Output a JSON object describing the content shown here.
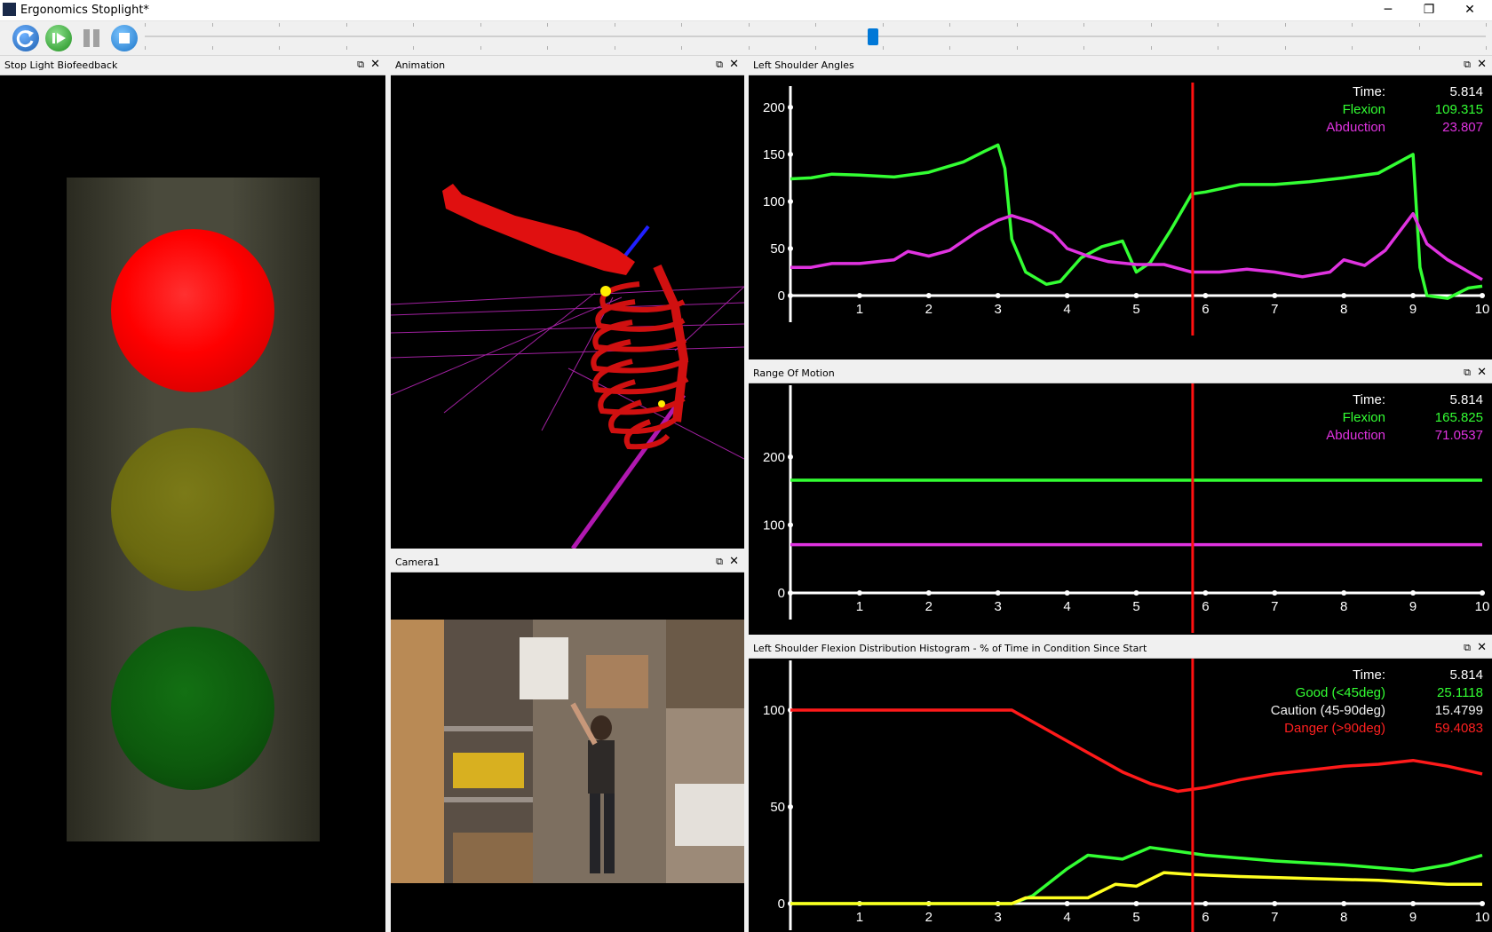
{
  "window": {
    "title": "Ergonomics Stoplight*",
    "minimize": "─",
    "maximize": "❐",
    "close": "✕"
  },
  "toolbar": {
    "buttons": [
      "reset-icon",
      "play-icon",
      "pause-icon",
      "stop-icon"
    ],
    "progress": 0.543
  },
  "panels": {
    "stoplight": {
      "title": "Stop Light Biofeedback",
      "active": "red",
      "colors": {
        "red": "#ff0000",
        "yellow": "#6b6a10",
        "green": "#0d5a0d"
      }
    },
    "animation": {
      "title": "Animation"
    },
    "camera": {
      "title": "Camera1"
    },
    "shoulder": {
      "title": "Left Shoulder Angles",
      "legend": [
        {
          "label": "Time:",
          "value": "5.814",
          "color": "#ffffff"
        },
        {
          "label": "Flexion",
          "value": "109.315",
          "color": "#33ff33"
        },
        {
          "label": "Abduction",
          "value": "23.807",
          "color": "#e033e0"
        }
      ]
    },
    "rom": {
      "title": "Range Of Motion",
      "legend": [
        {
          "label": "Time:",
          "value": "5.814",
          "color": "#ffffff"
        },
        {
          "label": "Flexion",
          "value": "165.825",
          "color": "#33ff33"
        },
        {
          "label": "Abduction",
          "value": "71.0537",
          "color": "#e033e0"
        }
      ]
    },
    "hist": {
      "title": "Left Shoulder Flexion Distribution Histogram - % of Time in Condition Since Start",
      "legend": [
        {
          "label": "Time:",
          "value": "5.814",
          "color": "#ffffff"
        },
        {
          "label": "Good (<45deg)",
          "value": "25.1118",
          "color": "#33ff33"
        },
        {
          "label": "Caution (45-90deg)",
          "value": "15.4799",
          "color": "#f0f0f0"
        },
        {
          "label": "Danger (>90deg)",
          "value": "59.4083",
          "color": "#ff2020"
        }
      ]
    }
  },
  "chart_data": [
    {
      "type": "line",
      "xlim": [
        0,
        10
      ],
      "ylim": [
        0,
        215
      ],
      "xticks": [
        1,
        2,
        3,
        4,
        5,
        6,
        7,
        8,
        9,
        10
      ],
      "yticks": [
        0,
        50,
        100,
        150,
        200
      ],
      "cursor_x": 5.814,
      "series": [
        {
          "name": "Flexion",
          "color": "#33ff33",
          "points": [
            [
              0,
              124
            ],
            [
              0.3,
              125
            ],
            [
              0.6,
              129
            ],
            [
              1.0,
              128
            ],
            [
              1.5,
              126
            ],
            [
              2.0,
              131
            ],
            [
              2.5,
              142
            ],
            [
              2.8,
              153
            ],
            [
              3.0,
              160
            ],
            [
              3.1,
              135
            ],
            [
              3.2,
              60
            ],
            [
              3.4,
              25
            ],
            [
              3.7,
              12
            ],
            [
              3.9,
              15
            ],
            [
              4.2,
              40
            ],
            [
              4.5,
              52
            ],
            [
              4.8,
              58
            ],
            [
              5.0,
              25
            ],
            [
              5.2,
              35
            ],
            [
              5.5,
              70
            ],
            [
              5.8,
              108
            ],
            [
              6.0,
              110
            ],
            [
              6.5,
              118
            ],
            [
              7.0,
              118
            ],
            [
              7.5,
              121
            ],
            [
              8.0,
              125
            ],
            [
              8.5,
              130
            ],
            [
              9.0,
              150
            ],
            [
              9.1,
              30
            ],
            [
              9.2,
              0
            ],
            [
              9.5,
              -3
            ],
            [
              9.8,
              8
            ],
            [
              10,
              10
            ]
          ]
        },
        {
          "name": "Abduction",
          "color": "#e033e0",
          "points": [
            [
              0,
              30
            ],
            [
              0.3,
              30
            ],
            [
              0.6,
              34
            ],
            [
              1.0,
              34
            ],
            [
              1.5,
              38
            ],
            [
              1.7,
              47
            ],
            [
              2.0,
              42
            ],
            [
              2.3,
              48
            ],
            [
              2.7,
              68
            ],
            [
              3.0,
              80
            ],
            [
              3.2,
              85
            ],
            [
              3.5,
              78
            ],
            [
              3.8,
              66
            ],
            [
              4.0,
              50
            ],
            [
              4.3,
              42
            ],
            [
              4.6,
              36
            ],
            [
              5.0,
              33
            ],
            [
              5.4,
              33
            ],
            [
              5.8,
              25
            ],
            [
              6.2,
              25
            ],
            [
              6.6,
              28
            ],
            [
              7.0,
              25
            ],
            [
              7.4,
              20
            ],
            [
              7.8,
              25
            ],
            [
              8.0,
              38
            ],
            [
              8.3,
              32
            ],
            [
              8.6,
              48
            ],
            [
              9.0,
              87
            ],
            [
              9.2,
              55
            ],
            [
              9.5,
              38
            ],
            [
              10,
              17
            ]
          ]
        }
      ]
    },
    {
      "type": "line",
      "xlim": [
        0,
        10
      ],
      "ylim": [
        0,
        295
      ],
      "xticks": [
        1,
        2,
        3,
        4,
        5,
        6,
        7,
        8,
        9,
        10
      ],
      "yticks": [
        0,
        100,
        200
      ],
      "cursor_x": 5.814,
      "series": [
        {
          "name": "Flexion",
          "color": "#33ff33",
          "points": [
            [
              0,
              165.825
            ],
            [
              10,
              165.825
            ]
          ]
        },
        {
          "name": "Abduction",
          "color": "#e033e0",
          "points": [
            [
              0,
              71.0537
            ],
            [
              10,
              71.0537
            ]
          ]
        }
      ]
    },
    {
      "type": "line",
      "xlim": [
        0,
        10
      ],
      "ylim": [
        0,
        122
      ],
      "xticks": [
        1,
        2,
        3,
        4,
        5,
        6,
        7,
        8,
        9,
        10
      ],
      "yticks": [
        0,
        50,
        100
      ],
      "cursor_x": 5.814,
      "series": [
        {
          "name": "Danger (>90deg)",
          "color": "#ff1a1a",
          "points": [
            [
              0,
              100
            ],
            [
              3.2,
              100
            ],
            [
              3.6,
              92
            ],
            [
              4.2,
              80
            ],
            [
              4.8,
              68
            ],
            [
              5.2,
              62
            ],
            [
              5.6,
              58
            ],
            [
              6.0,
              60
            ],
            [
              6.5,
              64
            ],
            [
              7.0,
              67
            ],
            [
              7.5,
              69
            ],
            [
              8.0,
              71
            ],
            [
              8.5,
              72
            ],
            [
              9.0,
              74
            ],
            [
              9.5,
              71
            ],
            [
              10,
              67
            ]
          ]
        },
        {
          "name": "Good (<45deg)",
          "color": "#33ff33",
          "points": [
            [
              0,
              0
            ],
            [
              3.2,
              0
            ],
            [
              3.5,
              4
            ],
            [
              4.0,
              18
            ],
            [
              4.3,
              25
            ],
            [
              4.8,
              23
            ],
            [
              5.2,
              29
            ],
            [
              5.6,
              27
            ],
            [
              6.0,
              25
            ],
            [
              7.0,
              22
            ],
            [
              8.0,
              20
            ],
            [
              9.0,
              17
            ],
            [
              9.5,
              20
            ],
            [
              10,
              25
            ]
          ]
        },
        {
          "name": "Caution (45-90deg)",
          "color": "#ffff20",
          "points": [
            [
              0,
              0
            ],
            [
              3.2,
              0
            ],
            [
              3.4,
              3
            ],
            [
              4.3,
              3
            ],
            [
              4.7,
              10
            ],
            [
              5.0,
              9
            ],
            [
              5.4,
              16
            ],
            [
              5.8,
              15
            ],
            [
              6.5,
              14
            ],
            [
              7.5,
              13
            ],
            [
              8.5,
              12
            ],
            [
              9.5,
              10
            ],
            [
              10,
              10
            ]
          ]
        }
      ]
    }
  ]
}
